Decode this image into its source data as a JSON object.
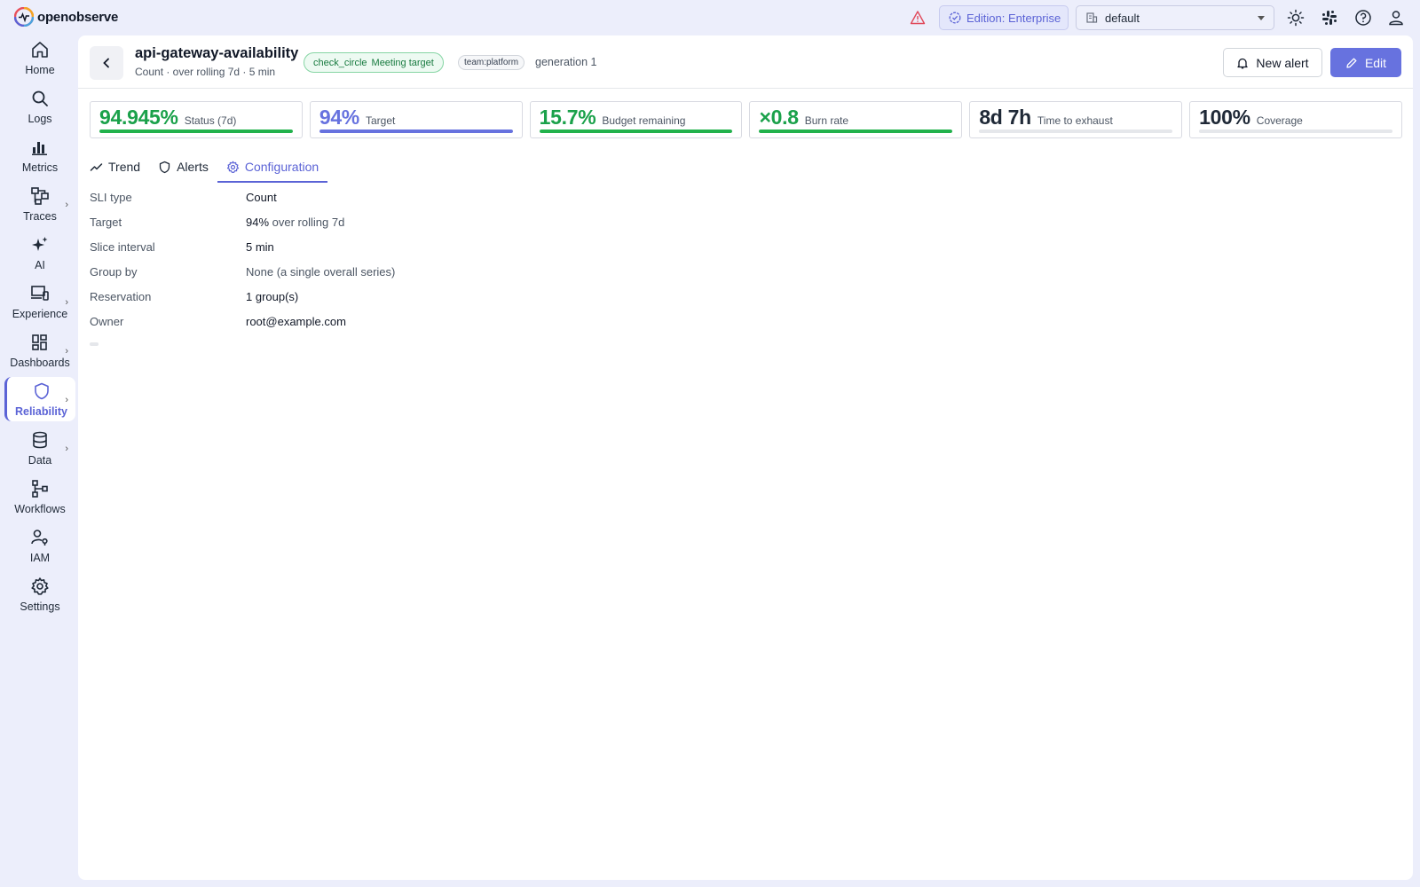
{
  "app": {
    "brand": "openobserve",
    "edition_label": "Edition: Enterprise",
    "org": "default"
  },
  "sidebar": {
    "items": [
      {
        "label": "Home"
      },
      {
        "label": "Logs"
      },
      {
        "label": "Metrics"
      },
      {
        "label": "Traces"
      },
      {
        "label": "AI"
      },
      {
        "label": "Experience"
      },
      {
        "label": "Dashboards"
      },
      {
        "label": "Reliability"
      },
      {
        "label": "Data"
      },
      {
        "label": "Workflows"
      },
      {
        "label": "IAM"
      },
      {
        "label": "Settings"
      }
    ]
  },
  "header": {
    "title": "api-gateway-availability",
    "subtitle": "Count · over rolling 7d · 5 min",
    "status_icon_text": "check_circle",
    "status_text": "Meeting target",
    "team_tag": "team:platform",
    "generation": "generation 1",
    "new_alert_label": "New alert",
    "edit_label": "Edit"
  },
  "stats": [
    {
      "value": "94.945%",
      "label": "Status (7d)",
      "color": "#1aa14a",
      "bar_color": "#22b24c",
      "fill": 1.0
    },
    {
      "value": "94%",
      "label": "Target",
      "color": "#6772df",
      "bar_color": "#6772df",
      "fill": 1.0
    },
    {
      "value": "15.7%",
      "label": "Budget remaining",
      "color": "#1aa14a",
      "bar_color": "#22b24c",
      "fill": 1.0
    },
    {
      "value": "×0.8",
      "label": "Burn rate",
      "color": "#1aa14a",
      "bar_color": "#22b24c",
      "fill": 1.0
    },
    {
      "value": "8d 7h",
      "label": "Time to exhaust",
      "color": "#1f2937",
      "bar_color": "#d9dbe2",
      "fill": 0.0
    },
    {
      "value": "100%",
      "label": "Coverage",
      "color": "#1f2937",
      "bar_color": "#d9dbe2",
      "fill": 0.0
    }
  ],
  "tabs": [
    {
      "label": "Trend"
    },
    {
      "label": "Alerts"
    },
    {
      "label": "Configuration"
    }
  ],
  "config": {
    "rows": [
      {
        "label": "SLI type",
        "value": "Count"
      },
      {
        "label": "Target",
        "value": "94%",
        "suffix": " over rolling 7d"
      },
      {
        "label": "Slice interval",
        "value": "5 min"
      },
      {
        "label": "Group by",
        "value": "None (a single overall series)"
      },
      {
        "label": "Reservation",
        "value": "1 group(s)"
      },
      {
        "label": "Owner",
        "value": "root@example.com"
      }
    ]
  },
  "colors": {
    "accent": "#5b63d6",
    "success": "#1aa14a",
    "warning": "#e0485a",
    "background": "#eceefb"
  }
}
